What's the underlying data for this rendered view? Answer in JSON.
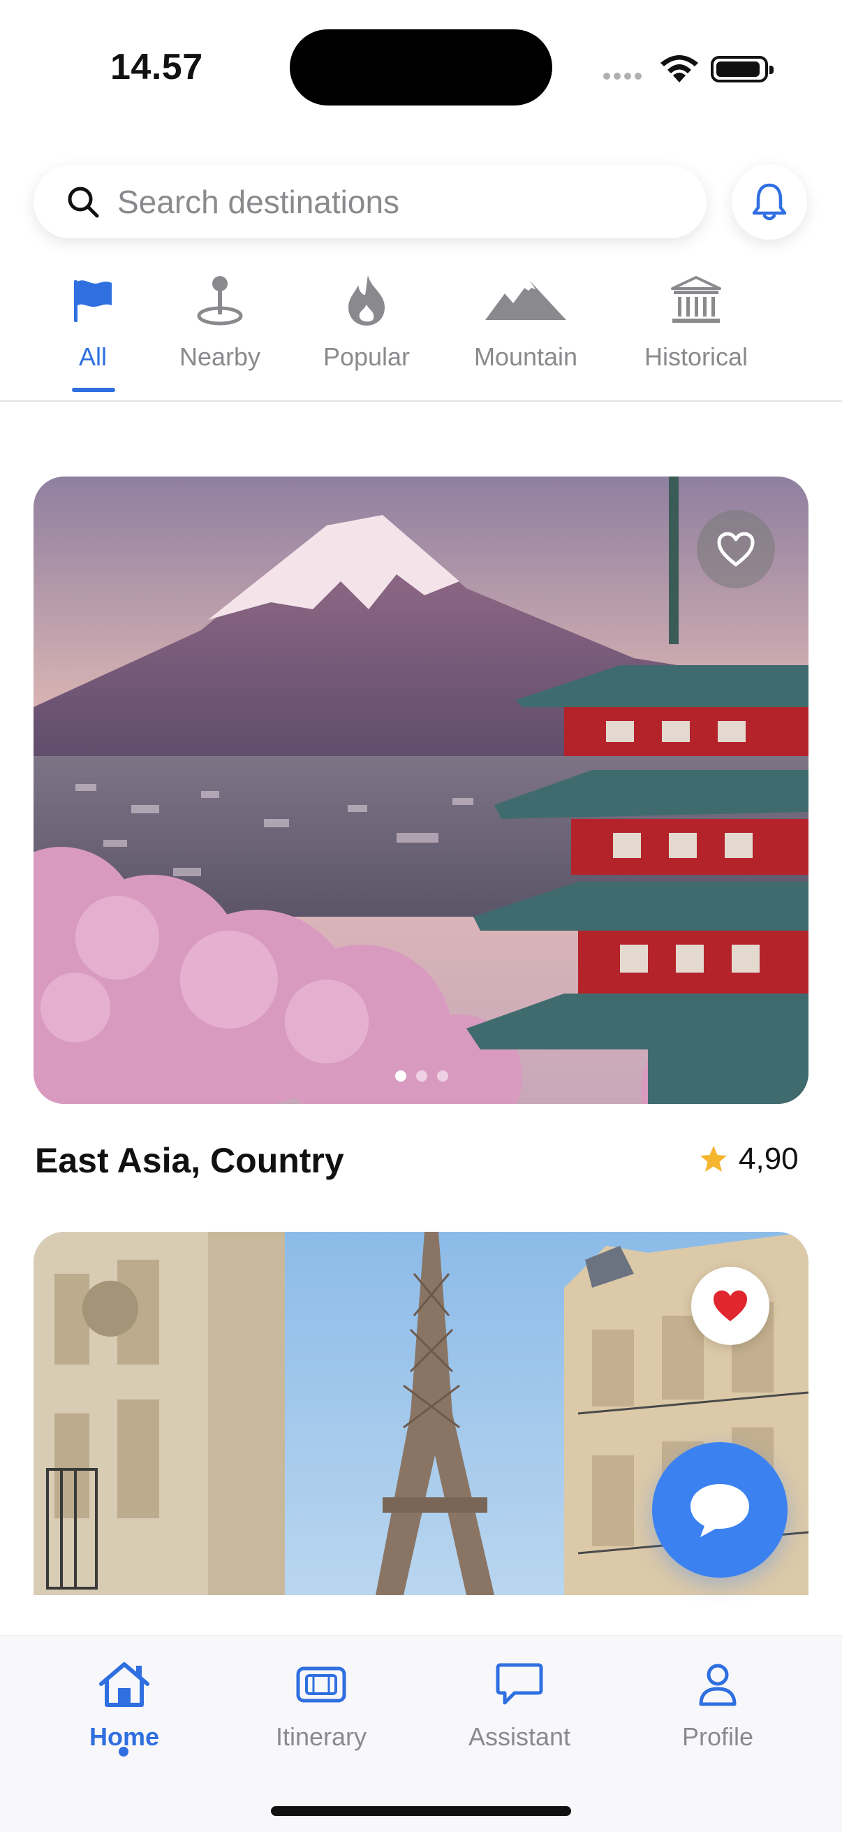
{
  "status_bar": {
    "time": "14.57"
  },
  "search": {
    "placeholder": "Search destinations"
  },
  "categories": [
    {
      "label": "All",
      "icon": "flag-icon",
      "active": true
    },
    {
      "label": "Nearby",
      "icon": "map-pin-icon",
      "active": false
    },
    {
      "label": "Popular",
      "icon": "flame-icon",
      "active": false
    },
    {
      "label": "Mountain",
      "icon": "mountain-icon",
      "active": false
    },
    {
      "label": "Historical",
      "icon": "museum-icon",
      "active": false
    }
  ],
  "cards": [
    {
      "title": "East Asia, Country",
      "rating": "4,90",
      "favorited": false,
      "image": "mount-fuji-pagoda-photo",
      "carousel_index": 1,
      "carousel_count": 3
    },
    {
      "title": "",
      "favorited": true,
      "image": "eiffel-tower-photo"
    }
  ],
  "nav": [
    {
      "label": "Home",
      "icon": "home-icon",
      "active": true
    },
    {
      "label": "Itinerary",
      "icon": "ticket-icon",
      "active": false
    },
    {
      "label": "Assistant",
      "icon": "chat-icon",
      "active": false
    },
    {
      "label": "Profile",
      "icon": "person-icon",
      "active": false
    }
  ],
  "colors": {
    "accent": "#2f6fe0",
    "fab": "#3b82f0",
    "heart": "#e0262f",
    "star": "#f5b52e",
    "inactive": "#8a8a8e"
  }
}
